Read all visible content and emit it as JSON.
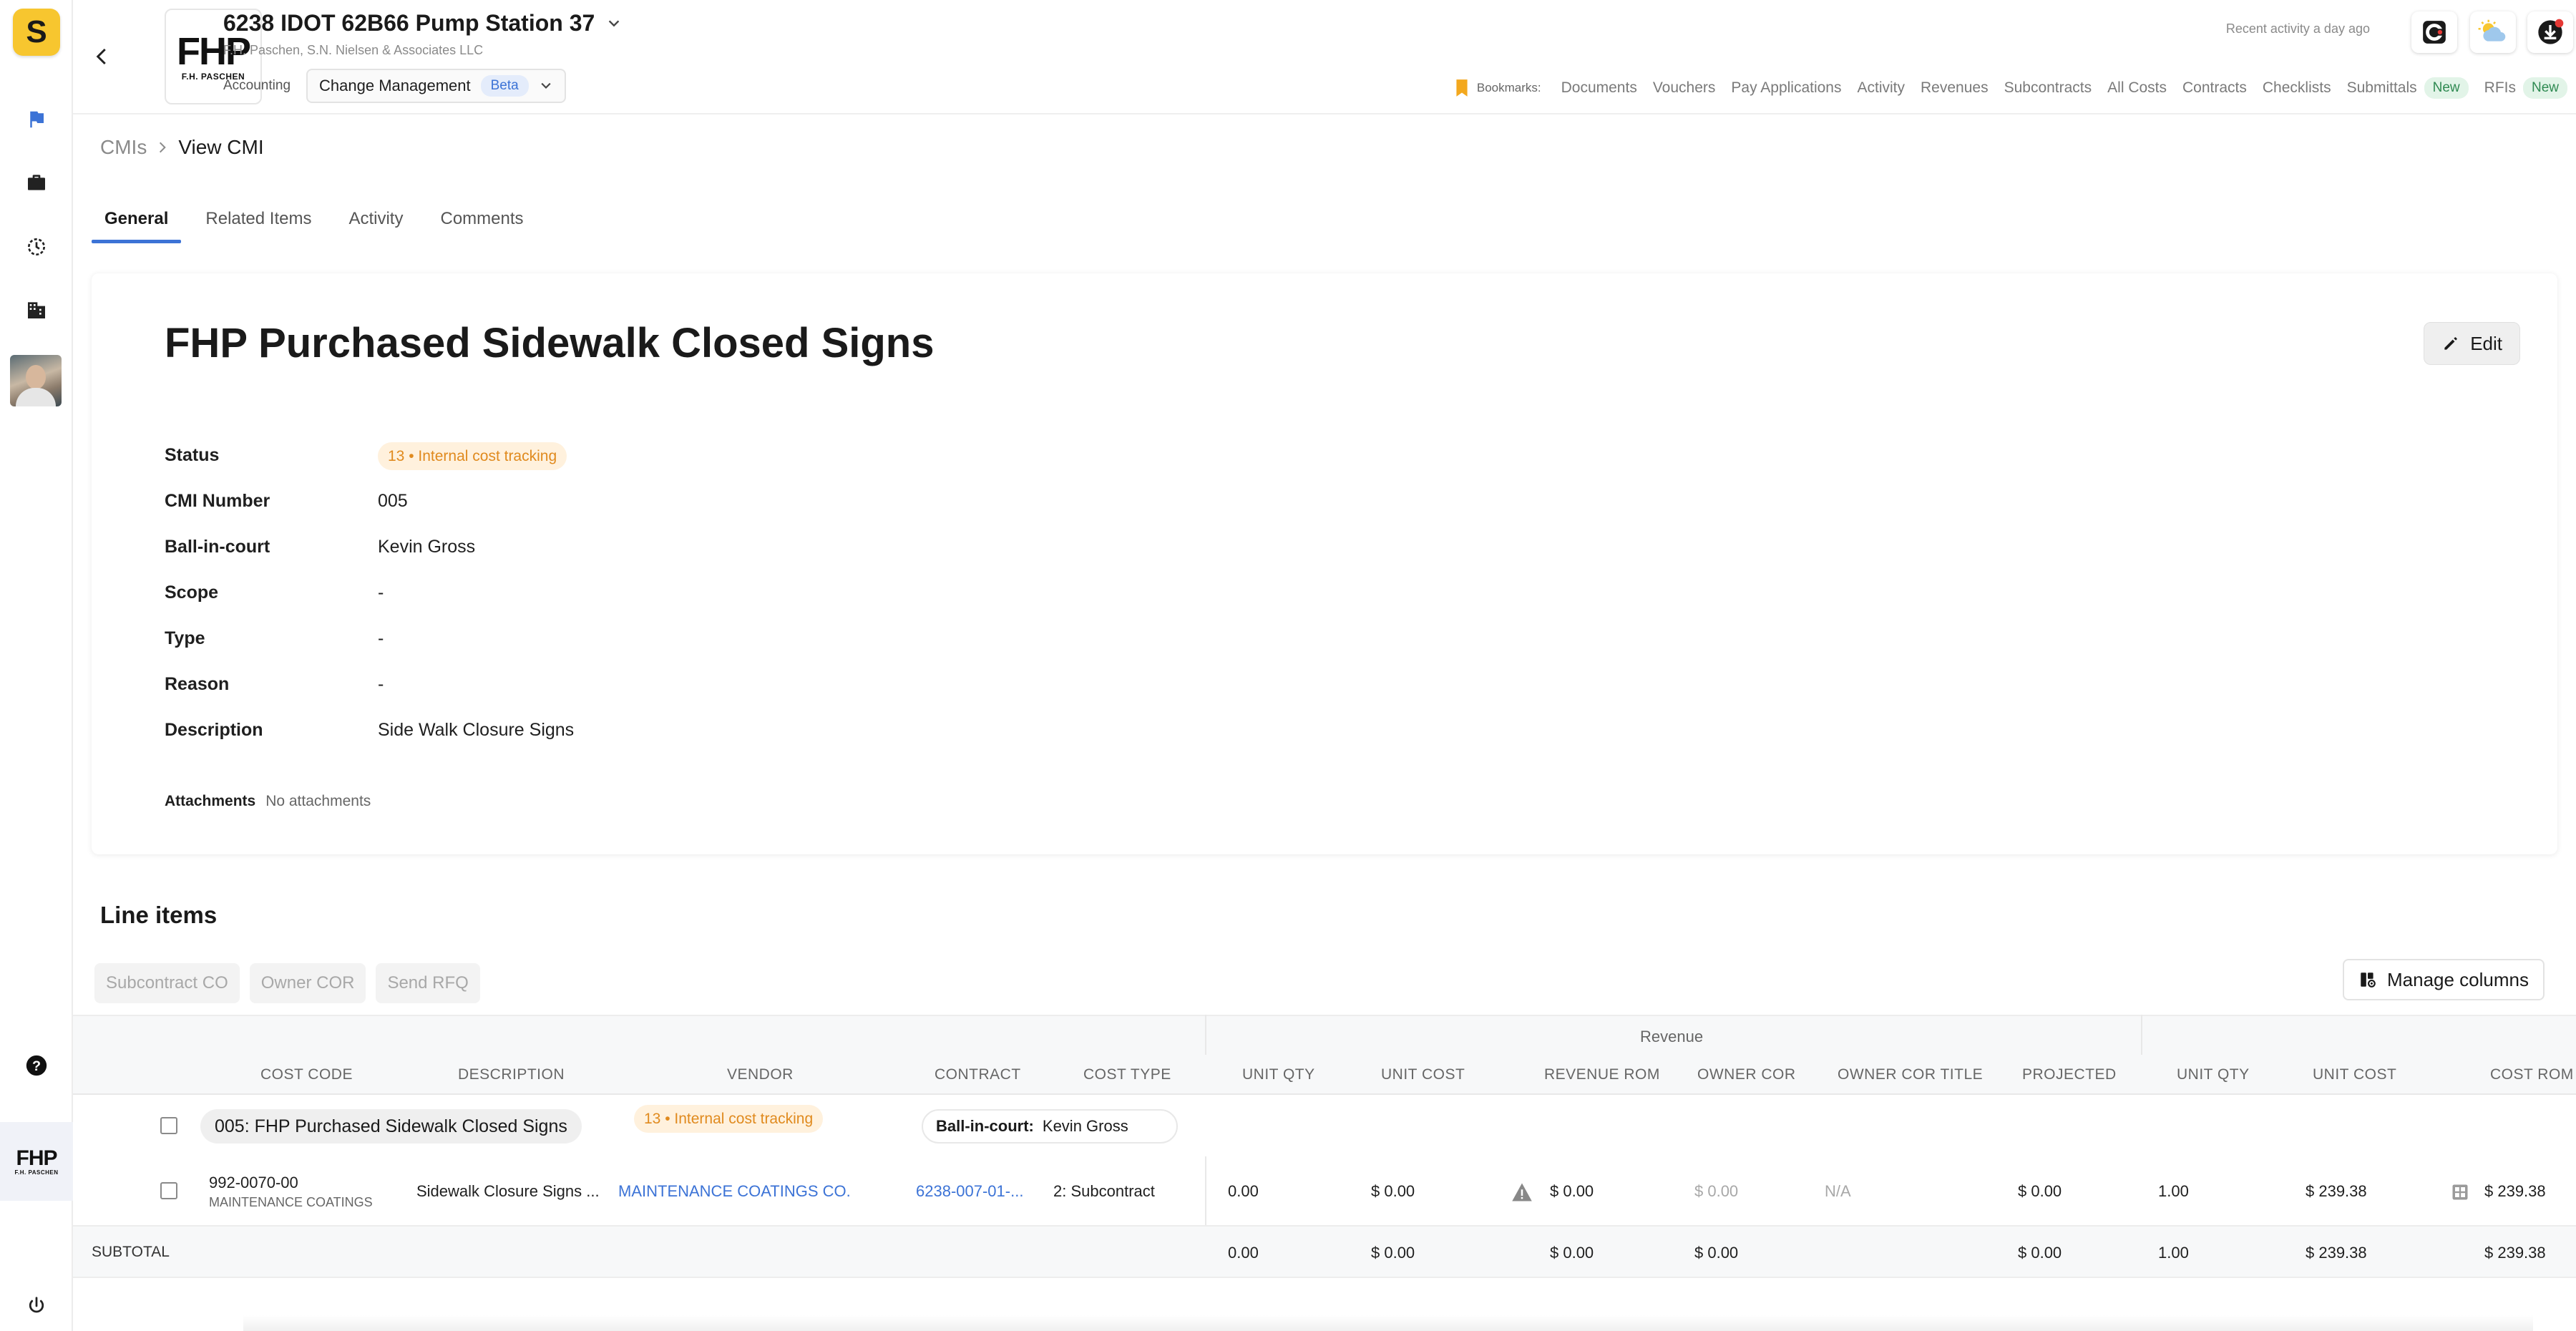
{
  "project": {
    "title": "6238 IDOT 62B66 Pump Station 37",
    "subtitle": "F.H. Paschen, S.N. Nielsen & Associates LLC",
    "module_prefix": "Accounting",
    "module": "Change Management",
    "module_badge": "Beta",
    "logo_text": "FHP",
    "logo_subtext": "F.H. PASCHEN"
  },
  "header": {
    "recent_activity": "Recent activity a day ago",
    "bookmarks_label": "Bookmarks:",
    "bookmarks": [
      {
        "label": "Documents"
      },
      {
        "label": "Vouchers"
      },
      {
        "label": "Pay Applications"
      },
      {
        "label": "Activity"
      },
      {
        "label": "Revenues"
      },
      {
        "label": "Subcontracts"
      },
      {
        "label": "All Costs"
      },
      {
        "label": "Contracts"
      },
      {
        "label": "Checklists"
      },
      {
        "label": "Submittals",
        "badge": "New"
      },
      {
        "label": "RFIs",
        "badge": "New"
      }
    ]
  },
  "rail": {
    "app_logo": "S",
    "company_logo": "FHP",
    "company_sub": "F.H. PASCHEN"
  },
  "breadcrumb": {
    "root": "CMIs",
    "current": "View CMI"
  },
  "tabs": [
    {
      "label": "General",
      "active": true
    },
    {
      "label": "Related Items",
      "active": false
    },
    {
      "label": "Activity",
      "active": false
    },
    {
      "label": "Comments",
      "active": false
    }
  ],
  "cmi": {
    "title": "FHP Purchased Sidewalk Closed Signs",
    "edit_label": "Edit",
    "fields": {
      "status_label": "Status",
      "status_value": "13 • Internal cost tracking",
      "number_label": "CMI Number",
      "number_value": "005",
      "bic_label": "Ball-in-court",
      "bic_value": "Kevin Gross",
      "scope_label": "Scope",
      "scope_value": "-",
      "type_label": "Type",
      "type_value": "-",
      "reason_label": "Reason",
      "reason_value": "-",
      "description_label": "Description",
      "description_value": "Side Walk Closure Signs"
    },
    "attachments_label": "Attachments",
    "attachments_value": "No attachments"
  },
  "line_items": {
    "title": "Line items",
    "actions": {
      "subcontract_co": "Subcontract CO",
      "owner_cor": "Owner COR",
      "send_rfq": "Send RFQ"
    },
    "manage_columns": "Manage columns",
    "group_header": "Revenue",
    "columns": {
      "cost_code": "COST CODE",
      "description": "DESCRIPTION",
      "vendor": "VENDOR",
      "contract": "CONTRACT",
      "cost_type": "COST TYPE",
      "unit_qty": "UNIT QTY",
      "unit_cost": "UNIT COST",
      "revenue_rom": "REVENUE ROM",
      "owner_cor": "OWNER COR",
      "owner_cor_title": "OWNER COR TITLE",
      "projected": "PROJECTED",
      "unit_qty_2": "UNIT QTY",
      "unit_cost_2": "UNIT COST",
      "cost_rom": "COST ROM"
    },
    "group": {
      "name": "005: FHP Purchased Sidewalk Closed Signs",
      "status": "13 • Internal cost tracking",
      "bic_label": "Ball-in-court:",
      "bic_value": "Kevin Gross"
    },
    "row": {
      "cost_code": "992-0070-00",
      "cost_code_sub": "MAINTENANCE COATINGS",
      "description": "Sidewalk Closure Signs ...",
      "vendor": "MAINTENANCE COATINGS CO.",
      "contract": "6238-007-01-...",
      "cost_type": "2: Subcontract",
      "unit_qty": "0.00",
      "unit_cost": "$ 0.00",
      "revenue_rom": "$ 0.00",
      "owner_cor": "$ 0.00",
      "owner_cor_title": "N/A",
      "projected": "$ 0.00",
      "unit_qty_2": "1.00",
      "unit_cost_2": "$ 239.38",
      "cost_rom": "$ 239.38"
    },
    "subtotal": {
      "label": "SUBTOTAL",
      "unit_qty": "0.00",
      "unit_cost": "$ 0.00",
      "revenue_rom": "$ 0.00",
      "owner_cor": "$ 0.00",
      "projected": "$ 0.00",
      "unit_qty_2": "1.00",
      "unit_cost_2": "$ 239.38",
      "cost_rom": "$ 239.38"
    }
  },
  "colors": {
    "accent": "#3c73d6",
    "status_orange": "#e08a1e",
    "status_orange_bg": "#fff1dd",
    "new_green": "#2f8a52",
    "brand_yellow": "#f7c62f"
  }
}
